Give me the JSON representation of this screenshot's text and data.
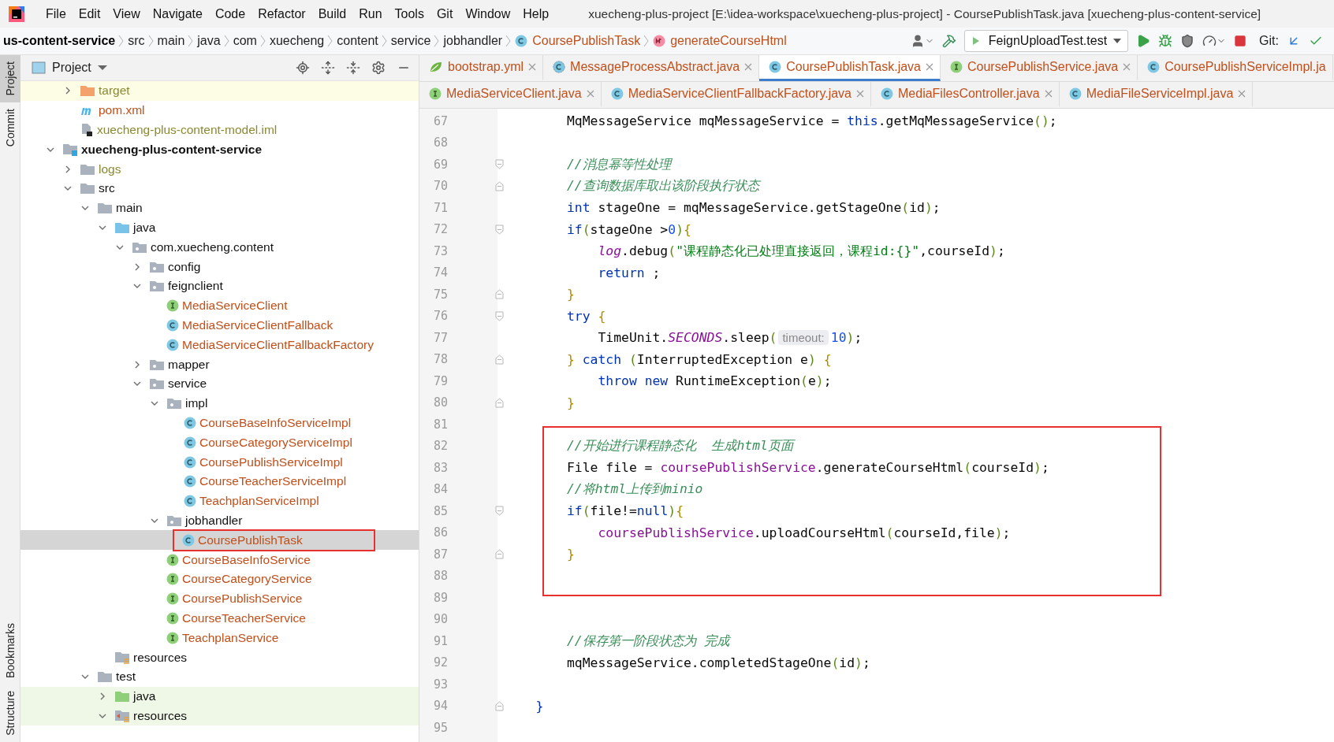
{
  "menu": [
    "File",
    "Edit",
    "View",
    "Navigate",
    "Code",
    "Refactor",
    "Build",
    "Run",
    "Tools",
    "Git",
    "Window",
    "Help"
  ],
  "window": {
    "title": "xuecheng-plus-project [E:\\idea-workspace\\xuecheng-plus-project] - CoursePublishTask.java [xuecheng-plus-content-service]"
  },
  "breadcrumb": [
    {
      "label": "us-content-service",
      "kind": "module"
    },
    {
      "label": "src",
      "kind": "text"
    },
    {
      "label": "main",
      "kind": "text"
    },
    {
      "label": "java",
      "kind": "text"
    },
    {
      "label": "com",
      "kind": "text"
    },
    {
      "label": "xuecheng",
      "kind": "text"
    },
    {
      "label": "content",
      "kind": "text"
    },
    {
      "label": "service",
      "kind": "text"
    },
    {
      "label": "jobhandler",
      "kind": "text"
    },
    {
      "label": "CoursePublishTask",
      "kind": "class"
    },
    {
      "label": "generateCourseHtml",
      "kind": "method"
    }
  ],
  "run_config": {
    "label": "FeignUploadTest.test"
  },
  "git": {
    "label": "Git:"
  },
  "side_tabs_top": [
    {
      "label": "Project",
      "selected": true
    },
    {
      "label": "Commit",
      "selected": false
    }
  ],
  "side_tabs_bottom": [
    {
      "label": "Bookmarks",
      "selected": false
    },
    {
      "label": "Structure",
      "selected": false
    }
  ],
  "project_panel": {
    "title": "Project",
    "tree": [
      {
        "children": [
          {
            "label": "target",
            "kind": "folder-excluded",
            "expanded": false,
            "ignored": true,
            "excluded": true
          },
          {
            "label": "pom.xml",
            "kind": "maven",
            "untracked": true
          },
          {
            "label": "xuecheng-plus-content-model.iml",
            "kind": "iml",
            "ignored": true
          }
        ]
      },
      {
        "label": "xuecheng-plus-content-service",
        "kind": "module",
        "expanded": true,
        "children": [
          {
            "label": "logs",
            "kind": "folder",
            "expanded": false,
            "ignored": true
          },
          {
            "label": "src",
            "kind": "folder",
            "expanded": true,
            "children": [
              {
                "label": "main",
                "kind": "folder",
                "expanded": true,
                "children": [
                  {
                    "label": "java",
                    "kind": "source",
                    "expanded": true,
                    "children": [
                      {
                        "label": "com.xuecheng.content",
                        "kind": "package",
                        "expanded": true,
                        "children": [
                          {
                            "label": "config",
                            "kind": "package",
                            "expanded": false
                          },
                          {
                            "label": "feignclient",
                            "kind": "package",
                            "expanded": true,
                            "children": [
                              {
                                "label": "MediaServiceClient",
                                "kind": "interface",
                                "untracked": true
                              },
                              {
                                "label": "MediaServiceClientFallback",
                                "kind": "class",
                                "untracked": true
                              },
                              {
                                "label": "MediaServiceClientFallbackFactory",
                                "kind": "class",
                                "untracked": true
                              }
                            ]
                          },
                          {
                            "label": "mapper",
                            "kind": "package",
                            "expanded": false
                          },
                          {
                            "label": "service",
                            "kind": "package",
                            "expanded": true,
                            "children": [
                              {
                                "label": "impl",
                                "kind": "package",
                                "expanded": true,
                                "children": [
                                  {
                                    "label": "CourseBaseInfoServiceImpl",
                                    "kind": "class",
                                    "untracked": true
                                  },
                                  {
                                    "label": "CourseCategoryServiceImpl",
                                    "kind": "class",
                                    "untracked": true
                                  },
                                  {
                                    "label": "CoursePublishServiceImpl",
                                    "kind": "class",
                                    "untracked": true
                                  },
                                  {
                                    "label": "CourseTeacherServiceImpl",
                                    "kind": "class",
                                    "untracked": true
                                  },
                                  {
                                    "label": "TeachplanServiceImpl",
                                    "kind": "class",
                                    "untracked": true
                                  }
                                ]
                              },
                              {
                                "label": "jobhandler",
                                "kind": "package",
                                "expanded": true,
                                "children": [
                                  {
                                    "label": "CoursePublishTask",
                                    "kind": "class",
                                    "untracked": true,
                                    "selected": true,
                                    "annotated": true
                                  }
                                ]
                              },
                              {
                                "label": "CourseBaseInfoService",
                                "kind": "interface",
                                "untracked": true
                              },
                              {
                                "label": "CourseCategoryService",
                                "kind": "interface",
                                "untracked": true
                              },
                              {
                                "label": "CoursePublishService",
                                "kind": "interface",
                                "untracked": true
                              },
                              {
                                "label": "CourseTeacherService",
                                "kind": "interface",
                                "untracked": true
                              },
                              {
                                "label": "TeachplanService",
                                "kind": "interface",
                                "untracked": true
                              }
                            ]
                          }
                        ]
                      }
                    ]
                  },
                  {
                    "label": "resources",
                    "kind": "resources"
                  }
                ]
              },
              {
                "label": "test",
                "kind": "folder",
                "expanded": true,
                "children": [
                  {
                    "label": "java",
                    "kind": "test-source",
                    "expanded": false,
                    "test_area": true
                  },
                  {
                    "label": "resources",
                    "kind": "test-resources",
                    "expanded": true,
                    "test_area": true
                  }
                ]
              }
            ]
          }
        ]
      }
    ]
  },
  "editor_tabs": [
    {
      "tabs": [
        {
          "label": "bootstrap.yml",
          "kind": "yaml",
          "selected": false,
          "closable": true
        },
        {
          "label": "MessageProcessAbstract.java",
          "kind": "abstract",
          "selected": false,
          "closable": true
        },
        {
          "label": "CoursePublishTask.java",
          "kind": "class",
          "selected": true,
          "closable": true
        },
        {
          "label": "CoursePublishService.java",
          "kind": "interface",
          "selected": false,
          "closable": true
        },
        {
          "label": "CoursePublishServiceImpl.ja",
          "kind": "class",
          "selected": false,
          "closable": false
        }
      ]
    },
    {
      "tabs": [
        {
          "label": "MediaServiceClient.java",
          "kind": "interface",
          "selected": false,
          "closable": true
        },
        {
          "label": "MediaServiceClientFallbackFactory.java",
          "kind": "class",
          "selected": false,
          "closable": true
        },
        {
          "label": "MediaFilesController.java",
          "kind": "class",
          "selected": false,
          "closable": true
        },
        {
          "label": "MediaFileServiceImpl.java",
          "kind": "class",
          "selected": false,
          "closable": true
        }
      ]
    }
  ],
  "code": {
    "lines": [
      {
        "number": "67",
        "tokens": [
          {
            "kind": "text",
            "text": "        MqMessageService mqMessageService = "
          },
          {
            "kind": "kw",
            "text": "this"
          },
          {
            "kind": "text",
            "text": ".getMqMessageService"
          },
          {
            "kind": "bracket",
            "text": "()"
          },
          {
            "kind": "text",
            "text": ";"
          }
        ]
      },
      {
        "number": "68"
      },
      {
        "number": "69",
        "fold_start": true,
        "tokens": [
          {
            "kind": "comment",
            "text": "        //消息幂等性处理"
          }
        ]
      },
      {
        "number": "70",
        "fold_end": true,
        "tokens": [
          {
            "kind": "comment",
            "text": "        //查询数据库取出该阶段执行状态"
          }
        ]
      },
      {
        "number": "71",
        "tokens": [
          {
            "kind": "kw",
            "text": "        int"
          },
          {
            "kind": "text",
            "text": " stageOne = mqMessageService.getStageOne"
          },
          {
            "kind": "bracket",
            "text": "("
          },
          {
            "kind": "text",
            "text": "id"
          },
          {
            "kind": "bracket",
            "text": ")"
          },
          {
            "kind": "text",
            "text": ";"
          }
        ]
      },
      {
        "number": "72",
        "fold_start": true,
        "tokens": [
          {
            "kind": "kw",
            "text": "        if"
          },
          {
            "kind": "bracket",
            "text": "("
          },
          {
            "kind": "text",
            "text": "stageOne >"
          },
          {
            "kind": "num",
            "text": "0"
          },
          {
            "kind": "bracket",
            "text": ")"
          },
          {
            "kind": "brace",
            "text": "{"
          }
        ]
      },
      {
        "number": "73",
        "tokens": [
          {
            "kind": "static",
            "text": "            log"
          },
          {
            "kind": "text",
            "text": ".debug"
          },
          {
            "kind": "bracket",
            "text": "("
          },
          {
            "kind": "str",
            "text": "\"课程静态化已处理直接返回，课程id:{}\""
          },
          {
            "kind": "text",
            "text": ",courseId"
          },
          {
            "kind": "bracket",
            "text": ")"
          },
          {
            "kind": "text",
            "text": ";"
          }
        ]
      },
      {
        "number": "74",
        "tokens": [
          {
            "kind": "kw",
            "text": "            return"
          },
          {
            "kind": "text",
            "text": " ;"
          }
        ]
      },
      {
        "number": "75",
        "fold_end": true,
        "tokens": [
          {
            "kind": "brace",
            "text": "        }"
          }
        ]
      },
      {
        "number": "76",
        "fold_start": true,
        "tokens": [
          {
            "kind": "kw",
            "text": "        try"
          },
          {
            "kind": "brace",
            "text": " {"
          }
        ]
      },
      {
        "number": "77",
        "tokens": [
          {
            "kind": "text",
            "text": "            TimeUnit."
          },
          {
            "kind": "static",
            "text": "SECONDS"
          },
          {
            "kind": "text",
            "text": ".sleep"
          },
          {
            "kind": "bracket",
            "text": "("
          },
          {
            "kind": "hint",
            "text": "timeout:"
          },
          {
            "kind": "num",
            "text": "10"
          },
          {
            "kind": "bracket",
            "text": ")"
          },
          {
            "kind": "text",
            "text": ";"
          }
        ]
      },
      {
        "number": "78",
        "fold_end": true,
        "tokens": [
          {
            "kind": "brace",
            "text": "        }"
          },
          {
            "kind": "kw",
            "text": " catch"
          },
          {
            "kind": "bracket",
            "text": " ("
          },
          {
            "kind": "text",
            "text": "InterruptedException e"
          },
          {
            "kind": "bracket",
            "text": ")"
          },
          {
            "kind": "brace",
            "text": " {"
          }
        ]
      },
      {
        "number": "79",
        "tokens": [
          {
            "kind": "kw",
            "text": "            throw"
          },
          {
            "kind": "kw",
            "text": " new"
          },
          {
            "kind": "text",
            "text": " RuntimeException"
          },
          {
            "kind": "bracket",
            "text": "("
          },
          {
            "kind": "text",
            "text": "e"
          },
          {
            "kind": "bracket",
            "text": ")"
          },
          {
            "kind": "text",
            "text": ";"
          }
        ]
      },
      {
        "number": "80",
        "fold_end": true,
        "tokens": [
          {
            "kind": "brace",
            "text": "        }"
          }
        ]
      },
      {
        "number": "81"
      },
      {
        "number": "82",
        "annotated": true,
        "tokens": [
          {
            "kind": "comment",
            "text": "        //开始进行课程静态化  生成html页面"
          }
        ]
      },
      {
        "number": "83",
        "annotated": true,
        "tokens": [
          {
            "kind": "text",
            "text": "        File file = "
          },
          {
            "kind": "field",
            "text": "coursePublishService"
          },
          {
            "kind": "text",
            "text": ".generateCourseHtml"
          },
          {
            "kind": "bracket",
            "text": "("
          },
          {
            "kind": "text",
            "text": "courseId"
          },
          {
            "kind": "bracket",
            "text": ")"
          },
          {
            "kind": "text",
            "text": ";"
          }
        ]
      },
      {
        "number": "84",
        "annotated": true,
        "tokens": [
          {
            "kind": "comment",
            "text": "        //将html上传到minio"
          }
        ]
      },
      {
        "number": "85",
        "annotated": true,
        "fold_start": true,
        "tokens": [
          {
            "kind": "kw",
            "text": "        if"
          },
          {
            "kind": "bracket",
            "text": "("
          },
          {
            "kind": "text",
            "text": "file!="
          },
          {
            "kind": "kw",
            "text": "null"
          },
          {
            "kind": "bracket",
            "text": ")"
          },
          {
            "kind": "brace",
            "text": "{"
          }
        ]
      },
      {
        "number": "86",
        "annotated": true,
        "tokens": [
          {
            "kind": "field",
            "text": "            coursePublishService"
          },
          {
            "kind": "text",
            "text": ".uploadCourseHtml"
          },
          {
            "kind": "bracket",
            "text": "("
          },
          {
            "kind": "text",
            "text": "courseId,file"
          },
          {
            "kind": "bracket",
            "text": ")"
          },
          {
            "kind": "text",
            "text": ";"
          }
        ]
      },
      {
        "number": "87",
        "annotated": true,
        "fold_end": true,
        "tokens": [
          {
            "kind": "brace",
            "text": "        }"
          }
        ]
      },
      {
        "number": "88",
        "annotated": true
      },
      {
        "number": "89"
      },
      {
        "number": "90"
      },
      {
        "number": "91",
        "tokens": [
          {
            "kind": "comment",
            "text": "        //保存第一阶段状态为 完成"
          }
        ]
      },
      {
        "number": "92",
        "tokens": [
          {
            "kind": "text",
            "text": "        mqMessageService.completedStageOne"
          },
          {
            "kind": "bracket",
            "text": "("
          },
          {
            "kind": "text",
            "text": "id"
          },
          {
            "kind": "bracket",
            "text": ")"
          },
          {
            "kind": "text",
            "text": ";"
          }
        ]
      },
      {
        "number": "93"
      },
      {
        "number": "94",
        "fold_end": true,
        "tokens": [
          {
            "kind": "outer",
            "text": "    }"
          }
        ]
      },
      {
        "number": "95"
      }
    ]
  }
}
